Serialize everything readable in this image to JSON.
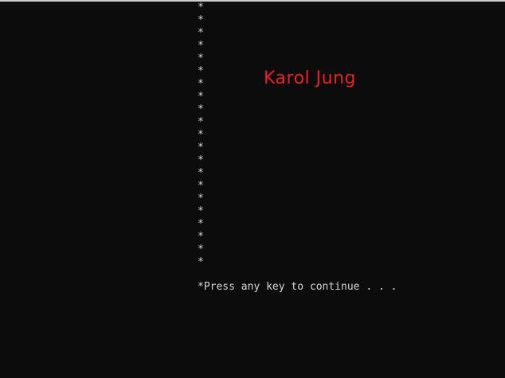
{
  "console": {
    "lines": [
      "*",
      "*",
      "*",
      "*",
      "*",
      "*",
      "*",
      "*",
      "*",
      "*",
      "*",
      "*",
      "*",
      "*",
      "*",
      "*",
      "*",
      "*",
      "*",
      "*",
      "*"
    ],
    "prompt": "*Press any key to continue . . .",
    "name": "Karol Jung"
  },
  "colors": {
    "background": "#0c0c0c",
    "text": "#d7d7d7",
    "name": "#e8202a"
  }
}
